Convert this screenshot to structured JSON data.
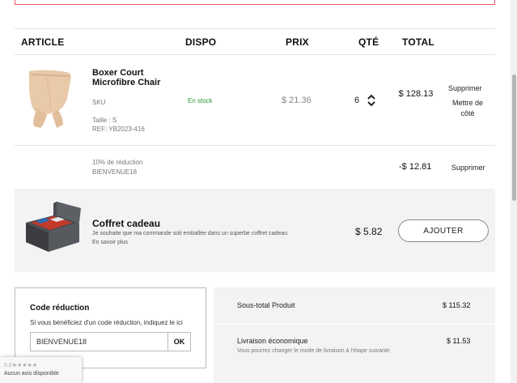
{
  "table": {
    "headers": {
      "article": "ARTICLE",
      "dispo": "DISPO",
      "prix": "PRIX",
      "qte": "QTÉ",
      "total": "TOTAL"
    }
  },
  "product": {
    "name": "Boxer Court Microfibre Chair",
    "sku": "SKU",
    "size": "Taille : S",
    "ref": "REF: YB2023-416",
    "availability": "En stock",
    "price": "$ 21.36",
    "quantity": "6",
    "total": "$ 128.13",
    "remove": "Supprimer",
    "set_aside": "Mettre de côté"
  },
  "discount": {
    "label": "10% de réduction",
    "code": "BIENVENUE18",
    "amount": "-$ 12.81",
    "remove": "Supprimer"
  },
  "gift": {
    "title": "Coffret cadeau",
    "description": "Je souhaite que ma commande soit emballée dans un superbe coffret cadeau",
    "more": "En savoir plus",
    "price": "$ 5.82",
    "button": "AJOUTER"
  },
  "promo": {
    "title": "Code réduction",
    "hint": "Si vous bénéficiez d'un code réduction, indiquez le ici",
    "value": "BIENVENUE18",
    "button": "OK"
  },
  "summary": {
    "subtotal_label": "Sous-total Produit",
    "subtotal_value": "$ 115.32",
    "shipping_label": "Livraison économique",
    "shipping_note": "Vous pourrez changer le mode de livraison à l'étape suivante",
    "shipping_value": "$ 11.53"
  },
  "reviews": {
    "score": "0.0★★★★★",
    "text": "Aucun avis disponible"
  },
  "colors": {
    "in_stock": "#2e9a3a",
    "alert_border": "#e85a6a",
    "panel_bg": "#f3f3f3"
  }
}
